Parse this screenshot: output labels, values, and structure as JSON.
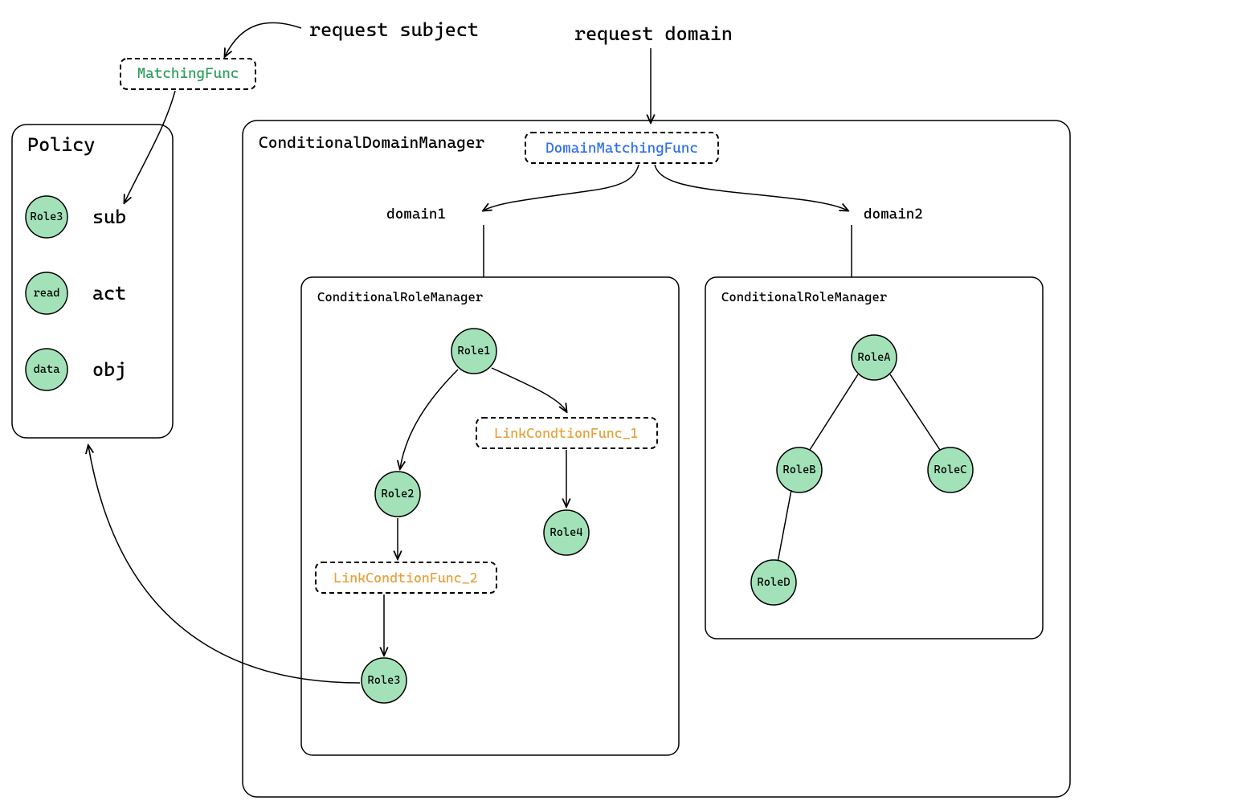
{
  "labels": {
    "request_subject": "request subject",
    "request_domain": "request domain",
    "matching_func": "MatchingFunc",
    "domain_matching_func": "DomainMatchingFunc",
    "conditional_domain_manager": "ConditionalDomainManager",
    "conditional_role_manager": "ConditionalRoleManager",
    "domain1": "domain1",
    "domain2": "domain2",
    "link_cond_1": "LinkCondtionFunc_1",
    "link_cond_2": "LinkCondtionFunc_2"
  },
  "policy": {
    "title": "Policy",
    "items": [
      {
        "circle": "Role3",
        "word": "sub"
      },
      {
        "circle": "read",
        "word": "act"
      },
      {
        "circle": "data",
        "word": "obj"
      }
    ]
  },
  "roles_domain1": {
    "r1": "Role1",
    "r2": "Role2",
    "r3": "Role3",
    "r4": "Role4"
  },
  "roles_domain2": {
    "a": "RoleA",
    "b": "RoleB",
    "c": "RoleC",
    "d": "RoleD"
  }
}
